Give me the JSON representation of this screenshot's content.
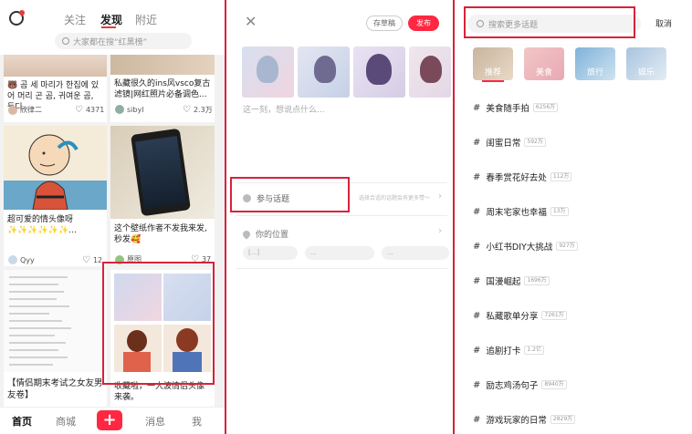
{
  "colors": {
    "accent": "#ff2741",
    "highlight_box": "#d8223a"
  },
  "discover": {
    "tabs": [
      "关注",
      "发现",
      "附近"
    ],
    "search_placeholder": "大家都在搜“红黑榜”",
    "cards": [
      {
        "text": "🐻 곰 세 마리가 한집에 있어 머리 곤 곰, 귀여운 곰, 둥디...",
        "author": "欣律二",
        "likes": "4371"
      },
      {
        "text": "私藏很久的ins风vsco复古滤镜|网红照片必备调色...",
        "author": "sibyl",
        "likes": "2.3万"
      },
      {
        "text": "超可爱的情头像呀 ✨✨✨✨✨✨...",
        "author": "Qyy",
        "likes": "12"
      },
      {
        "text": "这个壁纸作者不发我来发, 秒发🥰",
        "author": "原图",
        "likes": "37"
      },
      {
        "text": "【情侣期末考试之女友男友卷】",
        "author": "",
        "likes": ""
      },
      {
        "text": "收藏啦，一大波情侣头像来袭。",
        "author": "",
        "likes": ""
      }
    ],
    "bottom_nav": [
      "首页",
      "商城",
      "+",
      "消息",
      "我"
    ]
  },
  "compose": {
    "save_draft": "存草稿",
    "publish": "发布",
    "placeholder": "这一刻，想说点什么...",
    "topic_label": "参与话题",
    "topic_hint": "选择合适的话题会有更多赞～",
    "location_label": "你的位置",
    "location_chips": [
      "[...]",
      "...",
      "..."
    ]
  },
  "topics": {
    "search_placeholder": "搜索更多话题",
    "cancel": "取消",
    "categories": [
      "推荐",
      "美食",
      "旅行",
      "娱乐"
    ],
    "list": [
      {
        "name": "美食随手拍",
        "count": "6256万"
      },
      {
        "name": "闺蜜日常",
        "count": "592万"
      },
      {
        "name": "春季赏花好去处",
        "count": "112万"
      },
      {
        "name": "周末宅家也幸福",
        "count": "13万"
      },
      {
        "name": "小红书DIY大挑战",
        "count": "927万"
      },
      {
        "name": "国漫崛起",
        "count": "1696万"
      },
      {
        "name": "私藏歌单分享",
        "count": "7261万"
      },
      {
        "name": "追剧打卡",
        "count": "1.2亿"
      },
      {
        "name": "励志鸡汤句子",
        "count": "8940万"
      },
      {
        "name": "游戏玩家的日常",
        "count": "2829万"
      }
    ]
  }
}
